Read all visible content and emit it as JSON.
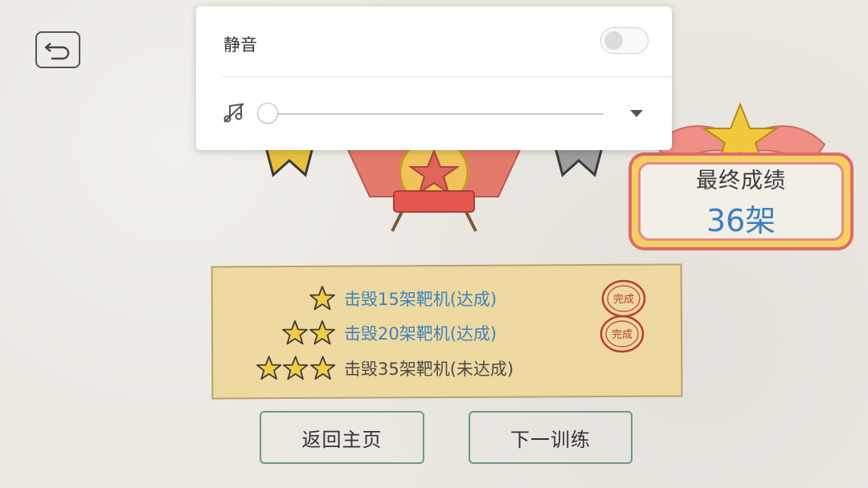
{
  "sound_panel": {
    "mute_label": "静音",
    "mute_enabled": false,
    "volume_level": 0
  },
  "score": {
    "title": "最终成绩",
    "value": "36架"
  },
  "tasks": [
    {
      "stars": 1,
      "text": "击毁15架靶机(达成)",
      "achieved": true,
      "stamp": "完成"
    },
    {
      "stars": 2,
      "text": "击毁20架靶机(达成)",
      "achieved": true,
      "stamp": "完成"
    },
    {
      "stars": 3,
      "text": "击毁35架靶机(未达成)",
      "achieved": false,
      "stamp": ""
    }
  ],
  "buttons": {
    "home": "返回主页",
    "next": "下一训练"
  },
  "colors": {
    "accent_blue": "#3f82bf",
    "stamp_red": "#c0392b",
    "note_yellow": "#eed9a0",
    "button_border": "#6b9a84"
  }
}
